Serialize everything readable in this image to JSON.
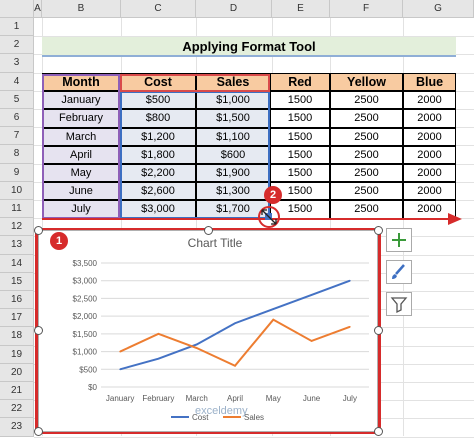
{
  "columns": [
    "A",
    "B",
    "C",
    "D",
    "E",
    "F",
    "G"
  ],
  "rows": [
    "1",
    "2",
    "3",
    "4",
    "5",
    "6",
    "7",
    "8",
    "9",
    "10",
    "11",
    "12",
    "13",
    "14",
    "15",
    "16",
    "17",
    "18",
    "19",
    "20",
    "21",
    "22",
    "23"
  ],
  "title": "Applying Format Tool",
  "table": {
    "headers": [
      "Month",
      "Cost",
      "Sales",
      "Red",
      "Yellow",
      "Blue"
    ],
    "rows": [
      [
        "January",
        "$500",
        "$1,000",
        "1500",
        "2500",
        "2000"
      ],
      [
        "February",
        "$800",
        "$1,500",
        "1500",
        "2500",
        "2000"
      ],
      [
        "March",
        "$1,200",
        "$1,100",
        "1500",
        "2500",
        "2000"
      ],
      [
        "April",
        "$1,800",
        "$600",
        "1500",
        "2500",
        "2000"
      ],
      [
        "May",
        "$2,200",
        "$1,900",
        "1500",
        "2500",
        "2000"
      ],
      [
        "June",
        "$2,600",
        "$1,300",
        "1500",
        "2500",
        "2000"
      ],
      [
        "July",
        "$3,000",
        "$1,700",
        "1500",
        "2500",
        "2000"
      ]
    ]
  },
  "badges": {
    "one": "1",
    "two": "2"
  },
  "chart_data": {
    "type": "line",
    "title": "Chart Title",
    "categories": [
      "January",
      "February",
      "March",
      "April",
      "May",
      "June",
      "July"
    ],
    "series": [
      {
        "name": "Cost",
        "values": [
          500,
          800,
          1200,
          1800,
          2200,
          2600,
          3000
        ],
        "color": "#4472c4"
      },
      {
        "name": "Sales",
        "values": [
          1000,
          1500,
          1100,
          600,
          1900,
          1300,
          1700
        ],
        "color": "#ed7d31"
      }
    ],
    "ylim": [
      0,
      3500
    ],
    "yticks": [
      "$0",
      "$500",
      "$1,000",
      "$1,500",
      "$2,000",
      "$2,500",
      "$3,000",
      "$3,500"
    ],
    "grid": true,
    "legend": "bottom"
  },
  "side_buttons": [
    "plus-icon",
    "brush-icon",
    "filter-icon"
  ],
  "watermark": "exceldemy",
  "colors": {
    "accent_red": "#d62b2b",
    "header_fill": "#f8cba1",
    "title_fill": "#e3efdb"
  }
}
